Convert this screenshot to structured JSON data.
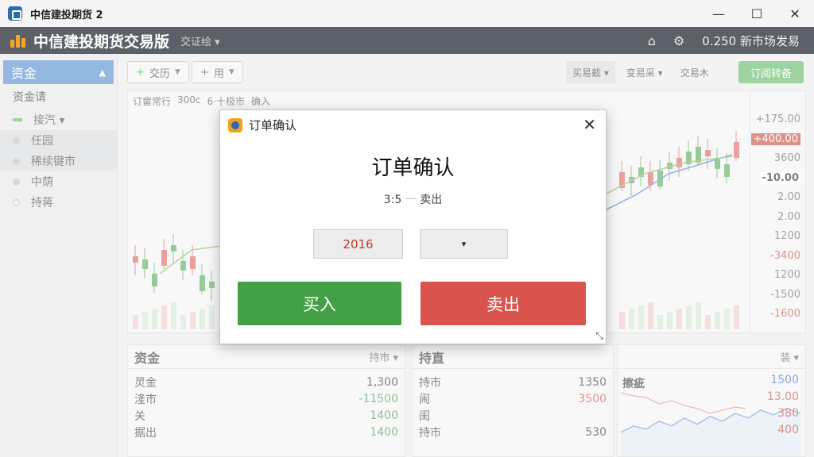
{
  "window": {
    "title": "中信建投期货 2",
    "controls": [
      "—",
      "☐",
      "✕"
    ]
  },
  "header": {
    "brand": "中信建投期货交易版",
    "sub": "交证绘 ▾",
    "ticker": "0.250 新市场发易"
  },
  "sidebar": {
    "header": "资金",
    "sub": "资金请",
    "items": [
      {
        "label": "接汽 ▾",
        "marker": "bar"
      },
      {
        "label": "任园",
        "marker": "dot"
      },
      {
        "label": "稀续键市",
        "marker": "dot",
        "selected": true
      },
      {
        "label": "中荫",
        "marker": "dot"
      },
      {
        "label": "持蒋",
        "marker": "ring"
      }
    ]
  },
  "toolbar": {
    "btn1": "交历",
    "btn2": "用",
    "right": [
      "买易截 ▾",
      "变易采 ▾",
      "交易木"
    ],
    "confirm": "订阅转备"
  },
  "chart": {
    "tabs": [
      "订畲常行",
      "300c",
      "6·十极市",
      "确入"
    ],
    "yticks": [
      {
        "label": "+175.00",
        "style": ""
      },
      {
        "label": "+400.00",
        "style": "tag"
      },
      {
        "label": "3600",
        "style": ""
      },
      {
        "label": "-10.00",
        "style": "hl"
      },
      {
        "label": "2.00",
        "style": ""
      },
      {
        "label": "2.00",
        "style": ""
      },
      {
        "label": "1200",
        "style": ""
      },
      {
        "label": "-3400",
        "style": "red"
      },
      {
        "label": "1200",
        "style": ""
      },
      {
        "label": "-1500",
        "style": ""
      },
      {
        "label": "-1600",
        "style": "red"
      }
    ],
    "colors": {
      "up": "#d9534f",
      "down": "#43a047"
    }
  },
  "panels": {
    "left": {
      "title": "资金",
      "header_right": "持市  ▾",
      "rows": [
        {
          "label": "灵金",
          "value": "1,300",
          "tone": ""
        },
        {
          "label": "湰市",
          "value": "-11500",
          "tone": "g"
        },
        {
          "label": "关",
          "value": "1400",
          "tone": "g"
        },
        {
          "label": "据出",
          "value": "1400",
          "tone": "g"
        }
      ]
    },
    "mid": {
      "title": "持直",
      "rows": [
        {
          "label": "持市",
          "value": "1350",
          "tone": ""
        },
        {
          "label": "闹",
          "value": "3500",
          "tone": "r"
        },
        {
          "label": "闺",
          "value": "",
          "tone": ""
        },
        {
          "label": "持市",
          "value": "530",
          "tone": ""
        }
      ]
    },
    "right": {
      "header_right": "装  ▾",
      "title": "擦疵",
      "values": [
        {
          "v": "1500",
          "tone": "b"
        },
        {
          "v": "13.00",
          "tone": "r"
        },
        {
          "v": "380",
          "tone": "r"
        },
        {
          "v": "400",
          "tone": "r"
        }
      ]
    }
  },
  "dialog": {
    "title": "订单确认",
    "heading": "订单确认",
    "sub_prefix": "3:5",
    "sub_faded": "一",
    "sub_suffix": "卖出",
    "field_value": "2016",
    "field_select": "▾",
    "buy": "买入",
    "sell": "卖出"
  }
}
